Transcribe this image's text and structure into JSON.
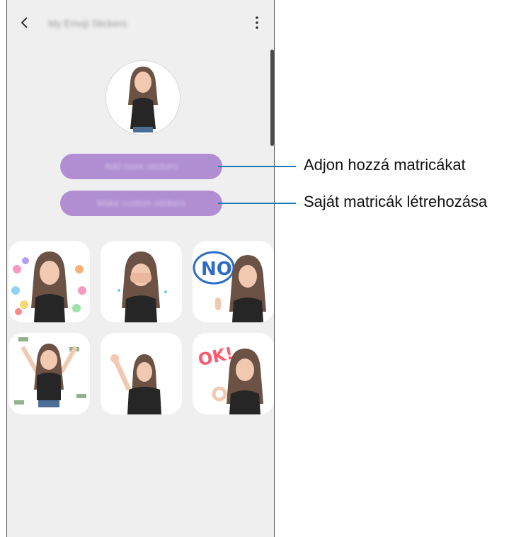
{
  "header": {
    "back_icon": "chevron-left-icon",
    "title": "My Emoji Stickers",
    "more_icon": "more-vertical-icon"
  },
  "actions": {
    "add_label": "Add more stickers",
    "make_label": "Make custom stickers"
  },
  "stickers": [
    {
      "name": "hearts",
      "text": ""
    },
    {
      "name": "crying",
      "text": ""
    },
    {
      "name": "no",
      "text": "NO"
    },
    {
      "name": "money",
      "text": ""
    },
    {
      "name": "wave",
      "text": ""
    },
    {
      "name": "ok",
      "text": "OK!"
    }
  ],
  "callouts": {
    "add": "Adjon hozzá matricákat",
    "make": "Saját matricák létrehozása"
  },
  "colors": {
    "button": "#b08ed1",
    "callout_line": "#1c78b0",
    "background": "#efefef"
  }
}
